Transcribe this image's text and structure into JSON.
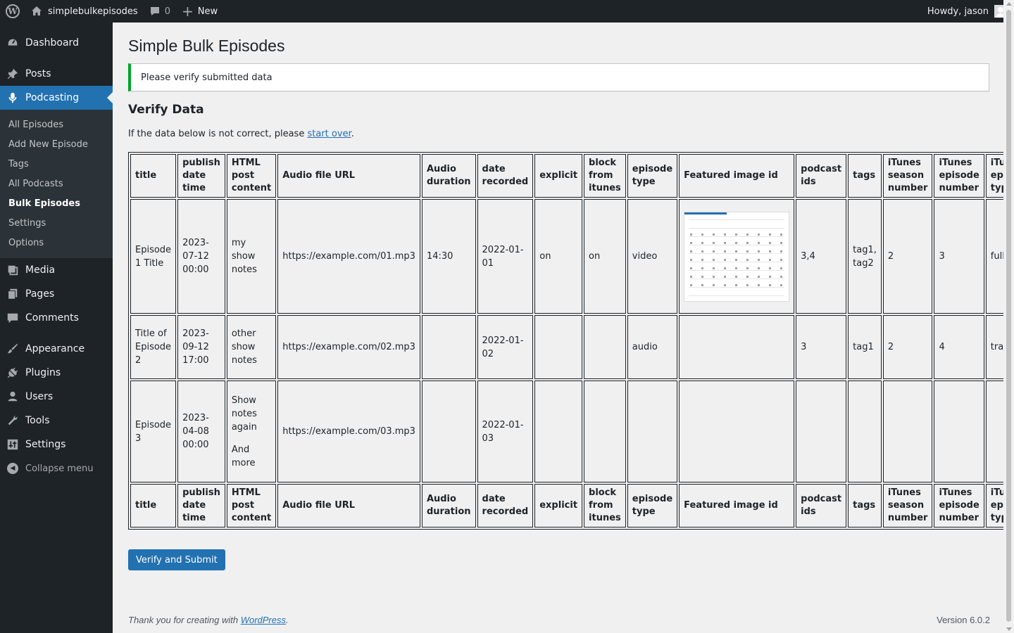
{
  "adminbar": {
    "site_name": "simplebulkepisodes",
    "comments_count": "0",
    "new_label": "New",
    "howdy": "Howdy, jason"
  },
  "menu": {
    "dashboard": "Dashboard",
    "posts": "Posts",
    "podcasting": "Podcasting",
    "sub": [
      "All Episodes",
      "Add New Episode",
      "Tags",
      "All Podcasts",
      "Bulk Episodes",
      "Settings",
      "Options"
    ],
    "media": "Media",
    "pages": "Pages",
    "comments": "Comments",
    "appearance": "Appearance",
    "plugins": "Plugins",
    "users": "Users",
    "tools": "Tools",
    "settings": "Settings",
    "collapse": "Collapse menu"
  },
  "page": {
    "title": "Simple Bulk Episodes",
    "notice": "Please verify submitted data",
    "section_title": "Verify Data",
    "intro_text": "If the data below is not correct, please ",
    "intro_link": "start over",
    "intro_end": ".",
    "submit_label": "Verify and Submit",
    "footer_text": "Thank you for creating with ",
    "footer_link": "WordPress",
    "footer_end": ".",
    "version": "Version 6.0.2"
  },
  "table": {
    "headers": [
      "title",
      "publish date time",
      "HTML post content",
      "Audio file URL",
      "Audio duration",
      "date recorded",
      "explicit",
      "block from itunes",
      "episode type",
      "Featured image id",
      "podcast ids",
      "tags",
      "iTunes season number",
      "iTunes episode number",
      "iTunes episode type"
    ],
    "rows": [
      {
        "title": "Episode 1 Title",
        "publish": "2023-07-12 00:00",
        "content": [
          "my show notes"
        ],
        "audio_url": "https://example.com/01.mp3",
        "duration": "14:30",
        "recorded": "2022-01-01",
        "explicit": "on",
        "block": "on",
        "type": "video",
        "podcast_ids": "3,4",
        "tags": "tag1, tag2",
        "season": "2",
        "episode": "3",
        "itunes_type": "full"
      },
      {
        "title": "Title of Episode 2",
        "publish": "2023-09-12 17:00",
        "content": [
          "other show notes"
        ],
        "audio_url": "https://example.com/02.mp3",
        "duration": "",
        "recorded": "2022-01-02",
        "explicit": "",
        "block": "",
        "type": "audio",
        "podcast_ids": "3",
        "tags": "tag1",
        "season": "2",
        "episode": "4",
        "itunes_type": "trailer"
      },
      {
        "title": "Episode 3",
        "publish": "2023-04-08 00:00",
        "content": [
          "Show notes again",
          "And more"
        ],
        "audio_url": "https://example.com/03.mp3",
        "duration": "",
        "recorded": "2022-01-03",
        "explicit": "",
        "block": "",
        "type": "",
        "podcast_ids": "",
        "tags": "",
        "season": "",
        "episode": "",
        "itunes_type": ""
      }
    ]
  },
  "colors": {
    "accent": "#2271b1",
    "sidebar": "#1d2327",
    "notice_success": "#00a32a"
  }
}
